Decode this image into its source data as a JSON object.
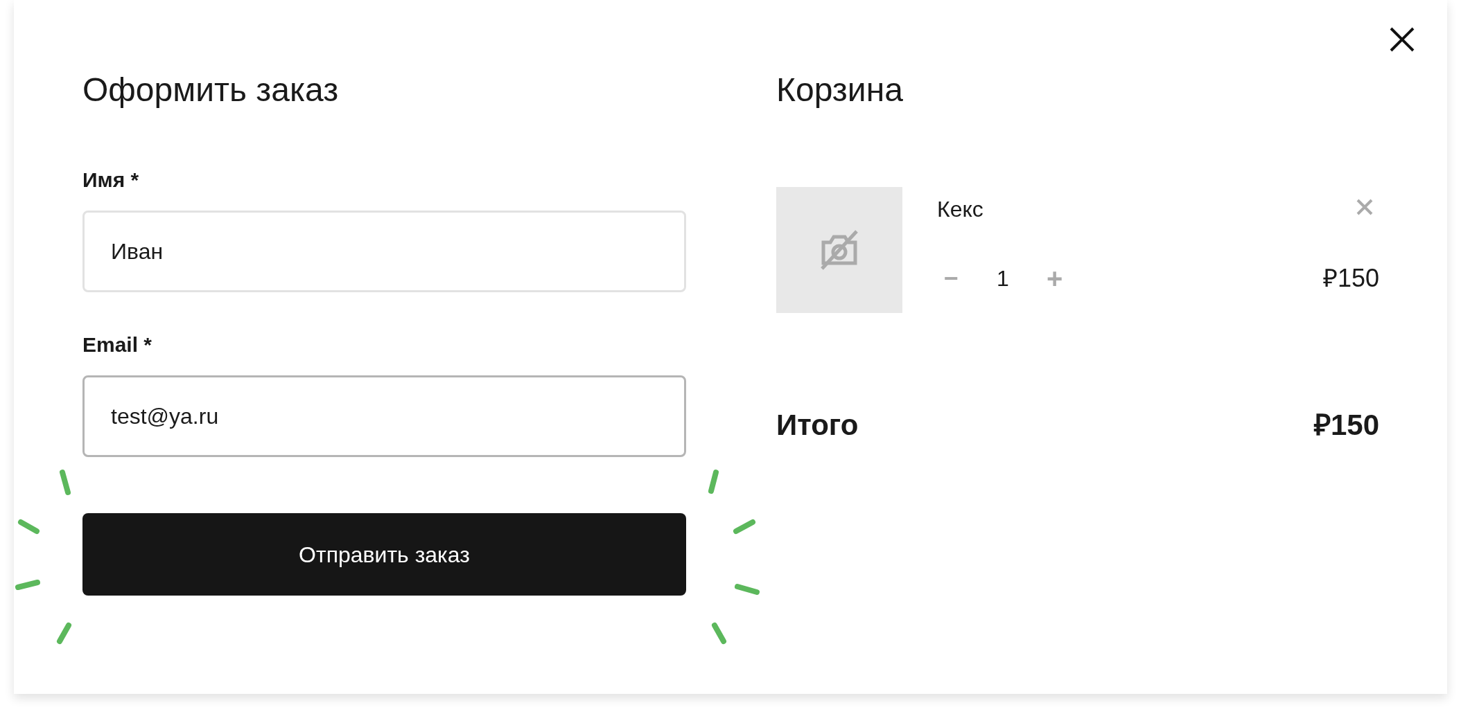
{
  "order_form": {
    "title": "Оформить заказ",
    "fields": [
      {
        "label": "Имя *",
        "value": "Иван",
        "focused": false
      },
      {
        "label": "Email *",
        "value": "test@ya.ru",
        "focused": true
      }
    ],
    "submit_button": "Отправить заказ"
  },
  "cart": {
    "title": "Корзина",
    "items": [
      {
        "name": "Кекс",
        "quantity": "1",
        "price": "₽150",
        "minus": "−",
        "plus": "+"
      }
    ],
    "total_label": "Итого",
    "total_value": "₽150"
  }
}
